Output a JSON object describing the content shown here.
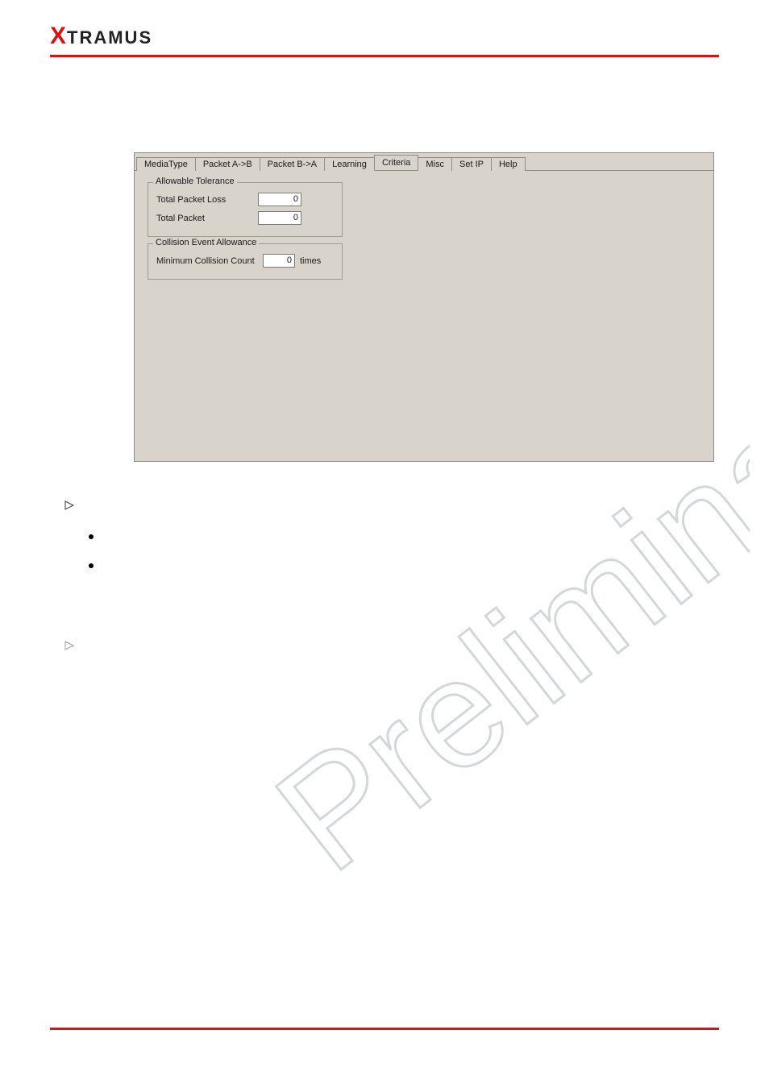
{
  "logo": {
    "x": "X",
    "rest": "TRAMUS"
  },
  "dialog": {
    "tabs": [
      "MediaType",
      "Packet A->B",
      "Packet B->A",
      "Learning",
      "Criteria",
      "Misc",
      "Set IP",
      "Help"
    ],
    "active_tab_index": 4,
    "group_allowable": {
      "legend": "Allowable Tolerance",
      "rows": [
        {
          "label": "Total Packet Loss",
          "value": "0"
        },
        {
          "label": "Total Packet",
          "value": "0"
        }
      ]
    },
    "group_collision": {
      "legend": "Collision Event Allowance",
      "rows": [
        {
          "label": "Minimum Collision Count",
          "value": "0",
          "suffix": "times"
        }
      ]
    }
  },
  "watermark_text": "Preliminary"
}
